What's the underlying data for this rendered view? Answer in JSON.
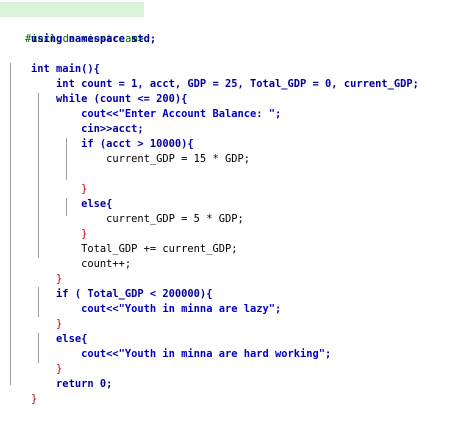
{
  "editor": {
    "lines": [
      "#include <iostream>",
      "using namespace std;",
      "",
      "int main(){",
      "    int count = 1, acct, GDP = 25, Total_GDP = 0, current_GDP;",
      "    while (count <= 200){",
      "        cout<<\"Enter Account Balance: \";",
      "        cin>>acct;",
      "        if (acct > 10000){",
      "            current_GDP = 15 * GDP;",
      "",
      "        }",
      "        else{",
      "            current_GDP = 5 * GDP;",
      "        }",
      "        Total_GDP += current_GDP;",
      "        count++;",
      "    }",
      "    if ( Total_GDP < 200000){",
      "        cout<<\"Youth in minna are lazy\";",
      "    }",
      "    else{",
      "        cout<<\"Youth in minna are hard working\";",
      "    }",
      "    return 0;",
      "}"
    ],
    "colors": {
      "background": "#ffffff",
      "include_highlight": "#d9f2d9",
      "keyword": "#0000a0",
      "preprocessor": "#006400",
      "string": "#0000c8",
      "number": "#c000c0",
      "operator": "#c000c0",
      "brace": "#c00000"
    }
  }
}
